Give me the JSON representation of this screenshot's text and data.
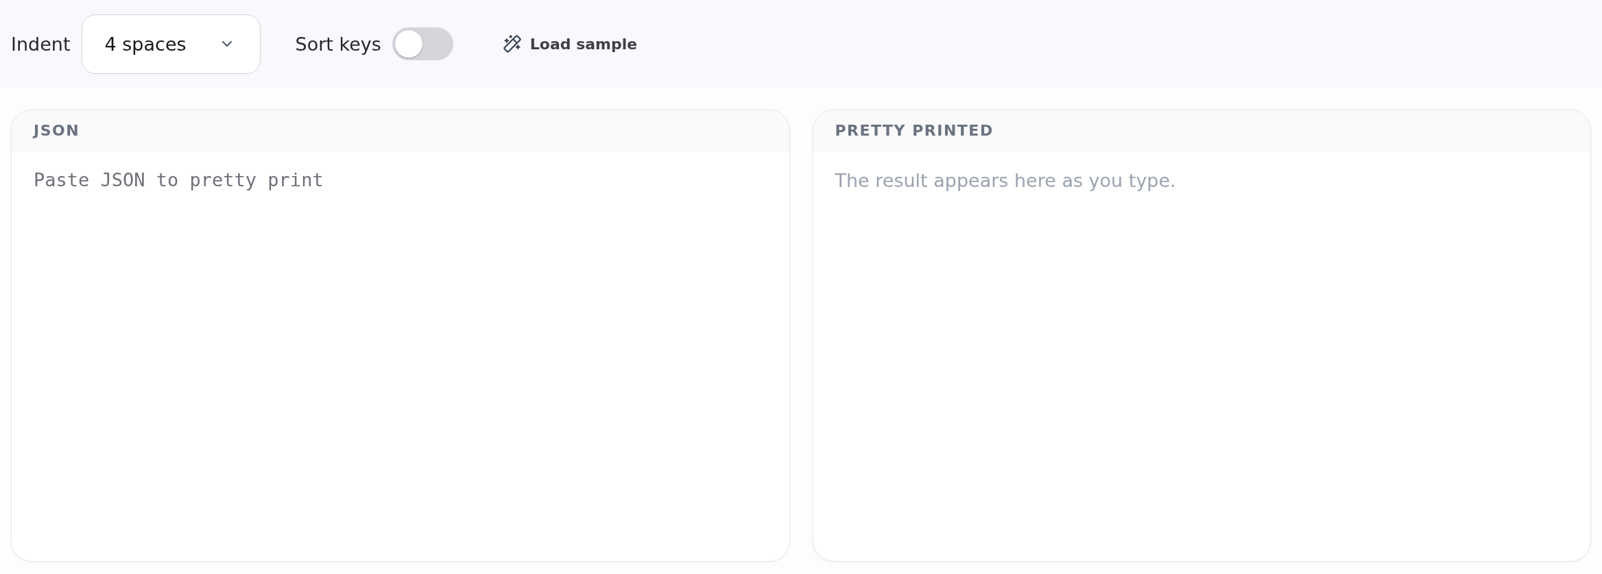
{
  "toolbar": {
    "indent": {
      "label": "Indent",
      "value": "4 spaces"
    },
    "sort_keys": {
      "label": "Sort keys",
      "on": false
    },
    "load_sample": {
      "label": "Load sample"
    }
  },
  "panels": [
    {
      "kind": "input",
      "title": "JSON",
      "placeholder": "Paste JSON to pretty print"
    },
    {
      "kind": "output",
      "title": "PRETTY PRINTED",
      "empty_text": "The result appears here as you type."
    }
  ]
}
